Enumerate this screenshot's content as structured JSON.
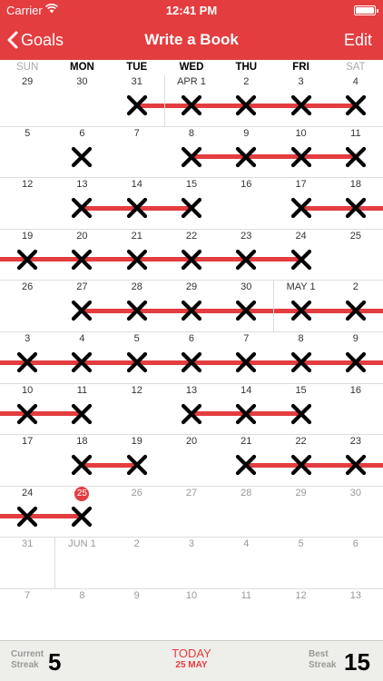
{
  "status": {
    "carrier": "Carrier",
    "time": "12:41 PM"
  },
  "nav": {
    "back_label": "Goals",
    "title": "Write a Book",
    "edit_label": "Edit"
  },
  "weekdays": [
    "SUN",
    "MON",
    "TUE",
    "WED",
    "THU",
    "FRI",
    "SAT"
  ],
  "colors": {
    "accent": "#e33d40",
    "grid": "#dddddd",
    "footer_bg": "#eeeeea"
  },
  "calendar": {
    "weeks": [
      [
        {
          "label": "29",
          "checked": false
        },
        {
          "label": "30",
          "checked": false
        },
        {
          "label": "31",
          "checked": true
        },
        {
          "label": "APR 1",
          "checked": true
        },
        {
          "label": "2",
          "checked": true
        },
        {
          "label": "3",
          "checked": true
        },
        {
          "label": "4",
          "checked": true
        }
      ],
      [
        {
          "label": "5",
          "checked": false
        },
        {
          "label": "6",
          "checked": true
        },
        {
          "label": "7",
          "checked": false
        },
        {
          "label": "8",
          "checked": true
        },
        {
          "label": "9",
          "checked": true
        },
        {
          "label": "10",
          "checked": true
        },
        {
          "label": "11",
          "checked": true
        }
      ],
      [
        {
          "label": "12",
          "checked": false
        },
        {
          "label": "13",
          "checked": true
        },
        {
          "label": "14",
          "checked": true
        },
        {
          "label": "15",
          "checked": true
        },
        {
          "label": "16",
          "checked": false
        },
        {
          "label": "17",
          "checked": true
        },
        {
          "label": "18",
          "checked": true
        }
      ],
      [
        {
          "label": "19",
          "checked": true
        },
        {
          "label": "20",
          "checked": true
        },
        {
          "label": "21",
          "checked": true
        },
        {
          "label": "22",
          "checked": true
        },
        {
          "label": "23",
          "checked": true
        },
        {
          "label": "24",
          "checked": true
        },
        {
          "label": "25",
          "checked": false
        }
      ],
      [
        {
          "label": "26",
          "checked": false
        },
        {
          "label": "27",
          "checked": true
        },
        {
          "label": "28",
          "checked": true
        },
        {
          "label": "29",
          "checked": true
        },
        {
          "label": "30",
          "checked": true
        },
        {
          "label": "MAY 1",
          "checked": true
        },
        {
          "label": "2",
          "checked": true
        }
      ],
      [
        {
          "label": "3",
          "checked": true
        },
        {
          "label": "4",
          "checked": true
        },
        {
          "label": "5",
          "checked": true
        },
        {
          "label": "6",
          "checked": true
        },
        {
          "label": "7",
          "checked": true
        },
        {
          "label": "8",
          "checked": true
        },
        {
          "label": "9",
          "checked": true
        }
      ],
      [
        {
          "label": "10",
          "checked": true
        },
        {
          "label": "11",
          "checked": true
        },
        {
          "label": "12",
          "checked": false
        },
        {
          "label": "13",
          "checked": true
        },
        {
          "label": "14",
          "checked": true
        },
        {
          "label": "15",
          "checked": true
        },
        {
          "label": "16",
          "checked": false
        }
      ],
      [
        {
          "label": "17",
          "checked": false
        },
        {
          "label": "18",
          "checked": true
        },
        {
          "label": "19",
          "checked": true
        },
        {
          "label": "20",
          "checked": false
        },
        {
          "label": "21",
          "checked": true
        },
        {
          "label": "22",
          "checked": true
        },
        {
          "label": "23",
          "checked": true
        }
      ],
      [
        {
          "label": "24",
          "checked": true
        },
        {
          "label": "25",
          "checked": true,
          "today": true
        },
        {
          "label": "26",
          "checked": false,
          "dim": true
        },
        {
          "label": "27",
          "checked": false,
          "dim": true
        },
        {
          "label": "28",
          "checked": false,
          "dim": true
        },
        {
          "label": "29",
          "checked": false,
          "dim": true
        },
        {
          "label": "30",
          "checked": false,
          "dim": true
        }
      ],
      [
        {
          "label": "31",
          "checked": false,
          "dim": true
        },
        {
          "label": "JUN 1",
          "checked": false,
          "dim": true
        },
        {
          "label": "2",
          "checked": false,
          "dim": true
        },
        {
          "label": "3",
          "checked": false,
          "dim": true
        },
        {
          "label": "4",
          "checked": false,
          "dim": true
        },
        {
          "label": "5",
          "checked": false,
          "dim": true
        },
        {
          "label": "6",
          "checked": false,
          "dim": true
        }
      ],
      [
        {
          "label": "7",
          "checked": false,
          "dim": true
        },
        {
          "label": "8",
          "checked": false,
          "dim": true
        },
        {
          "label": "9",
          "checked": false,
          "dim": true
        },
        {
          "label": "10",
          "checked": false,
          "dim": true
        },
        {
          "label": "11",
          "checked": false,
          "dim": true
        },
        {
          "label": "12",
          "checked": false,
          "dim": true
        },
        {
          "label": "13",
          "checked": false,
          "dim": true
        }
      ]
    ],
    "incoming_streak_rows": [
      3,
      5,
      6,
      8
    ]
  },
  "footer": {
    "current_label_1": "Current",
    "current_label_2": "Streak",
    "current_value": "5",
    "today_label": "TODAY",
    "today_date": "25 MAY",
    "best_label_1": "Best",
    "best_label_2": "Streak",
    "best_value": "15"
  }
}
